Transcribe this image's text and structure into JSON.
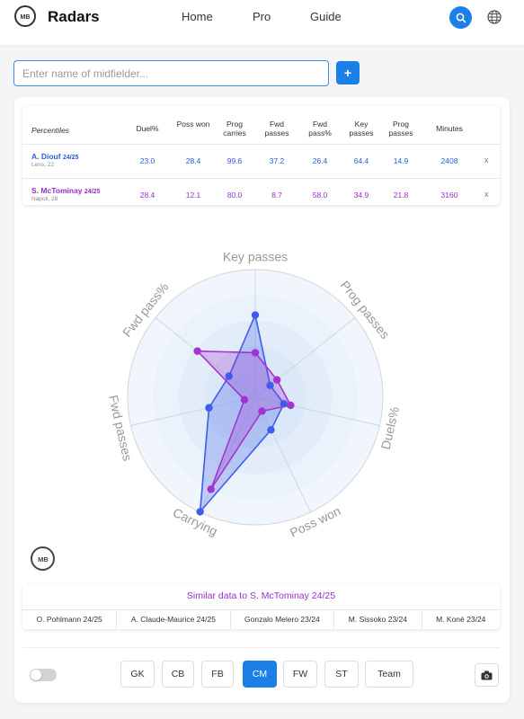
{
  "header": {
    "brand": "Radars",
    "nav": [
      "Home",
      "Pro",
      "Guide"
    ],
    "icons": {
      "search": "search-icon",
      "language": "globe-icon",
      "logo": "mb-logo-icon"
    }
  },
  "search": {
    "placeholder": "Enter name of midfielder...",
    "value": "",
    "add_label": "+"
  },
  "table": {
    "first_header": "Percentiles",
    "columns": [
      "Duel%",
      "Poss won",
      "Prog carries",
      "Fwd passes",
      "Fwd pass%",
      "Key passes",
      "Prog passes",
      "Minutes"
    ],
    "remove_label": "x",
    "rows": [
      {
        "name": "A. Diouf",
        "season": "24/25",
        "sub": "Lens, 22",
        "values": [
          "23.0",
          "28.4",
          "99.6",
          "37.2",
          "26.4",
          "64.4",
          "14.9",
          "2408"
        ],
        "color": "#2a5bd7"
      },
      {
        "name": "S. McTominay",
        "season": "24/25",
        "sub": "Napoli, 28",
        "values": [
          "28.4",
          "12.1",
          "80.0",
          "8.7",
          "58.0",
          "34.9",
          "21.8",
          "3160"
        ],
        "color": "#9a2fc6"
      }
    ]
  },
  "radar": {
    "axes": [
      "Key passes",
      "Prog passes",
      "Duels%",
      "Poss won",
      "Carrying",
      "Fwd passes",
      "Fwd pass%"
    ],
    "colors": {
      "player1": "#3f5de8",
      "player2": "#a235d0"
    }
  },
  "similar": {
    "title": "Similar data to S. McTominay 24/25",
    "items": [
      "O. Pohlmann 24/25",
      "A. Claude-Maurice 24/25",
      "Gonzalo Melero 23/24",
      "M. Sissoko 23/24",
      "M. Koné 23/24"
    ]
  },
  "positions": {
    "buttons": [
      "GK",
      "CB",
      "FB",
      "CM",
      "FW",
      "ST",
      "Team"
    ],
    "active": "CM",
    "camera_icon": "camera-icon"
  }
}
